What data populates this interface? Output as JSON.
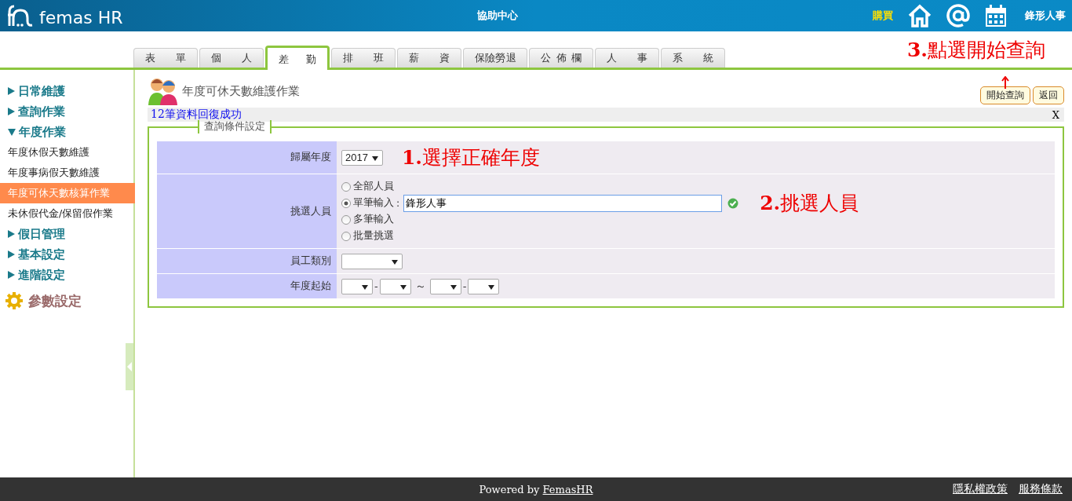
{
  "header": {
    "logo": "femas HR",
    "center_link": "協助中心",
    "buy_link": "購買",
    "user": "鋒形人事"
  },
  "tabs": [
    {
      "label": "表 單",
      "selected": false
    },
    {
      "label": "個 人",
      "selected": false
    },
    {
      "label": "差 勤",
      "selected": true
    },
    {
      "label": "排 班",
      "selected": false
    },
    {
      "label": "薪 資",
      "selected": false
    },
    {
      "label": "保險勞退",
      "selected": false
    },
    {
      "label": "公 佈 欄",
      "selected": false
    },
    {
      "label": "人 事",
      "selected": false
    },
    {
      "label": "系 統",
      "selected": false
    }
  ],
  "sidebar": {
    "items": [
      {
        "kind": "group",
        "label": "日常維護",
        "expanded": false
      },
      {
        "kind": "group",
        "label": "查詢作業",
        "expanded": false
      },
      {
        "kind": "group",
        "label": "年度作業",
        "expanded": true,
        "children": [
          {
            "label": "年度休假天數維護",
            "selected": false
          },
          {
            "label": "年度事病假天數維護",
            "selected": false
          },
          {
            "label": "年度可休天數核算作業",
            "selected": true
          },
          {
            "label": "未休假代金/保留假作業",
            "selected": false
          }
        ]
      },
      {
        "kind": "group",
        "label": "假日管理",
        "expanded": false
      },
      {
        "kind": "group",
        "label": "基本設定",
        "expanded": false
      },
      {
        "kind": "group",
        "label": "進階設定",
        "expanded": false
      },
      {
        "kind": "settings",
        "label": "參數設定"
      }
    ]
  },
  "page": {
    "title": "年度可休天數維護作業",
    "buttons": [
      "開始查詢",
      "返回"
    ],
    "message": "12筆資料回復成功",
    "close": "X"
  },
  "annotations": [
    "**1.**選擇正確年度",
    "**2.**挑選人員",
    "**3.**點選開始查詢"
  ],
  "form": {
    "legend": "查詢條件設定",
    "year": {
      "label": "歸屬年度",
      "value": "2017"
    },
    "people": {
      "label": "挑選人員",
      "options": [
        {
          "label": "全部人員",
          "selected": false
        },
        {
          "label": "單筆輸入",
          "selected": true
        },
        {
          "label": "多筆輸入",
          "selected": false
        },
        {
          "label": "批量挑選",
          "selected": false
        }
      ],
      "colon": ":",
      "value": "鋒形人事"
    },
    "type": {
      "label": "員工類別"
    },
    "start": {
      "label": "年度起始",
      "dash": "-",
      "tilde": "～"
    }
  },
  "footer": {
    "powered": "Powered by ",
    "brand": "FemasHR",
    "links": [
      "隱私權政策",
      "服務條款"
    ]
  }
}
